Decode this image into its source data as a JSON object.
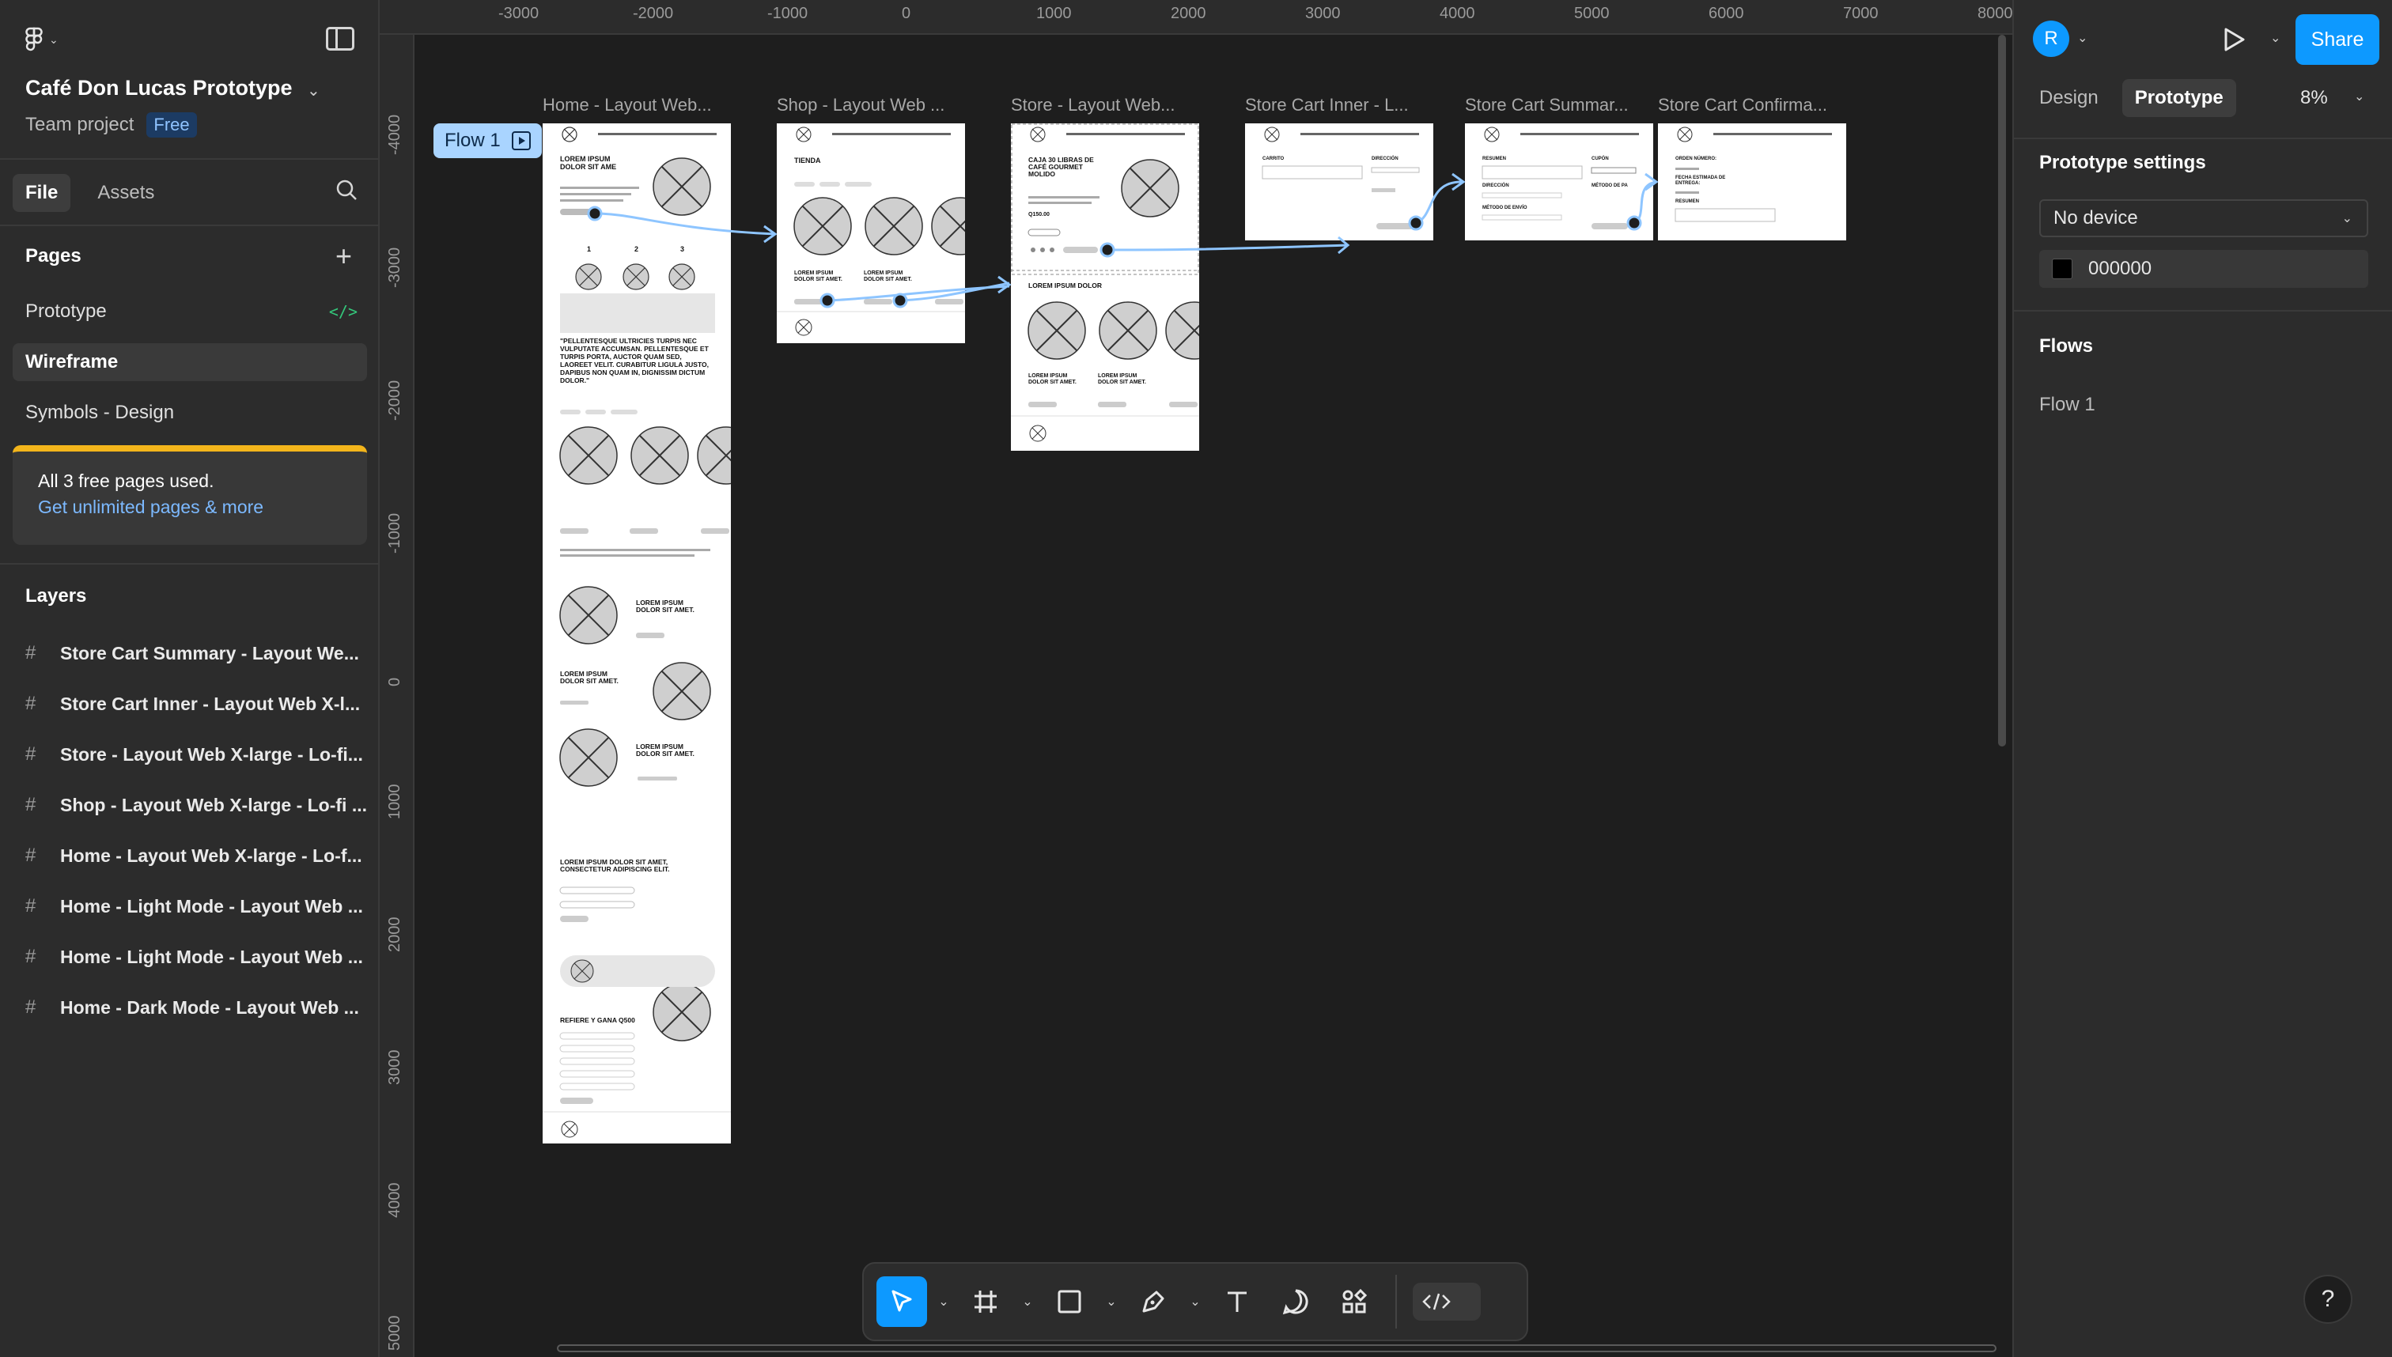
{
  "project": {
    "name": "Café Don Lucas Prototype",
    "team": "Team project",
    "plan_badge": "Free"
  },
  "left_tabs": [
    "File",
    "Assets"
  ],
  "pages": {
    "title": "Pages",
    "items": [
      "Prototype",
      "Wireframe",
      "Symbols - Design"
    ],
    "active_index": 1
  },
  "banner": {
    "text": "All 3 free pages used.",
    "link": "Get unlimited pages & more",
    "accent": "#f3b51b"
  },
  "layers": {
    "title": "Layers",
    "items": [
      "Store Cart Summary - Layout We...",
      "Store Cart Inner - Layout Web X-l...",
      "Store - Layout Web X-large - Lo-fi...",
      "Shop - Layout Web X-large - Lo-fi ...",
      "Home - Layout Web X-large - Lo-f...",
      "Home - Light Mode - Layout Web ...",
      "Home - Light Mode - Layout Web ...",
      "Home - Dark Mode - Layout Web ..."
    ]
  },
  "ruler": {
    "top": [
      "-3000",
      "-2000",
      "-1000",
      "0",
      "1000",
      "2000",
      "3000",
      "4000",
      "5000",
      "6000",
      "7000",
      "8000"
    ],
    "left": [
      "-4000",
      "-3000",
      "-2000",
      "-1000",
      "0",
      "1000",
      "2000",
      "3000",
      "4000",
      "5000"
    ]
  },
  "canvas": {
    "flow_badge": "Flow 1",
    "frames": [
      "Home - Layout Web...",
      "Shop - Layout Web ...",
      "Store - Layout Web...",
      "Store Cart Inner - L...",
      "Store Cart Summar...",
      "Store Cart Confirma..."
    ],
    "wire": {
      "home_heading": "LOREM IPSUM DOLOR SIT AME",
      "home_steps": [
        "1",
        "2",
        "3"
      ],
      "home_quote": "\"PELLENTESQUE ULTRICIES TURPIS NEC VULPUTATE ACCUMSAN. PELLENTESQUE ET TURPIS PORTA, AUCTOR QUAM SED, LAOREET VELIT. CURABITUR LIGULA JUSTO, DAPIBUS NON QUAM IN, DIGNISSIM DICTUM DOLOR.\"",
      "home_feature_a": "LOREM IPSUM DOLOR SIT AMET.",
      "home_feature_b": "LOREM IPSUM DOLOR SIT AMET.",
      "home_feature_c": "LOREM IPSUM DOLOR SIT AMET.",
      "home_form_heading": "LOREM IPSUM DOLOR SIT AMET, CONSECTETUR ADIPISCING ELIT.",
      "home_refer": "REFIERE Y GANA Q500",
      "shop_heading": "TIENDA",
      "store_heading": "CAJA 30 LIBRAS DE CAFÉ GOURMET MOLIDO",
      "store_price": "Q150.00",
      "store_sub": "LOREM IPSUM DOLOR",
      "product_label": "LOREM IPSUM DOLOR SIT AMET.",
      "cart_inner_left": "CARRITO",
      "cart_inner_right": "DIRECCIÓN",
      "cart_summary_left": "RESUMEN",
      "cart_summary_right": "CUPÓN",
      "cart_summary_dir": "DIRECCIÓN",
      "cart_summary_pay": "MÉTODO DE ENVÍO",
      "cart_summary_pay2": "MÉTODO DE PA",
      "confirm_order": "ORDEN NÚMERO:",
      "confirm_date": "FECHA ESTIMADA DE ENTREGA:",
      "confirm_summary": "RESUMEN"
    }
  },
  "toolbar": {
    "tools": [
      "move-tool",
      "frame-tool",
      "shape-tool",
      "pen-tool",
      "text-tool",
      "comment-tool",
      "actions-tool",
      "dev-mode-toggle"
    ]
  },
  "right": {
    "avatar_initial": "R",
    "share": "Share",
    "tabs": [
      "Design",
      "Prototype"
    ],
    "active_tab": 1,
    "zoom": "8%",
    "settings_title": "Prototype settings",
    "device": "No device",
    "bg_color": "000000",
    "flows_title": "Flows",
    "flows": [
      "Flow 1"
    ],
    "help": "?"
  },
  "colors": {
    "accent": "#0d99ff",
    "panel": "#2c2c2c",
    "canvas": "#1e1e1e",
    "flow": "#a9d4ff",
    "code_green": "#34c77b"
  }
}
